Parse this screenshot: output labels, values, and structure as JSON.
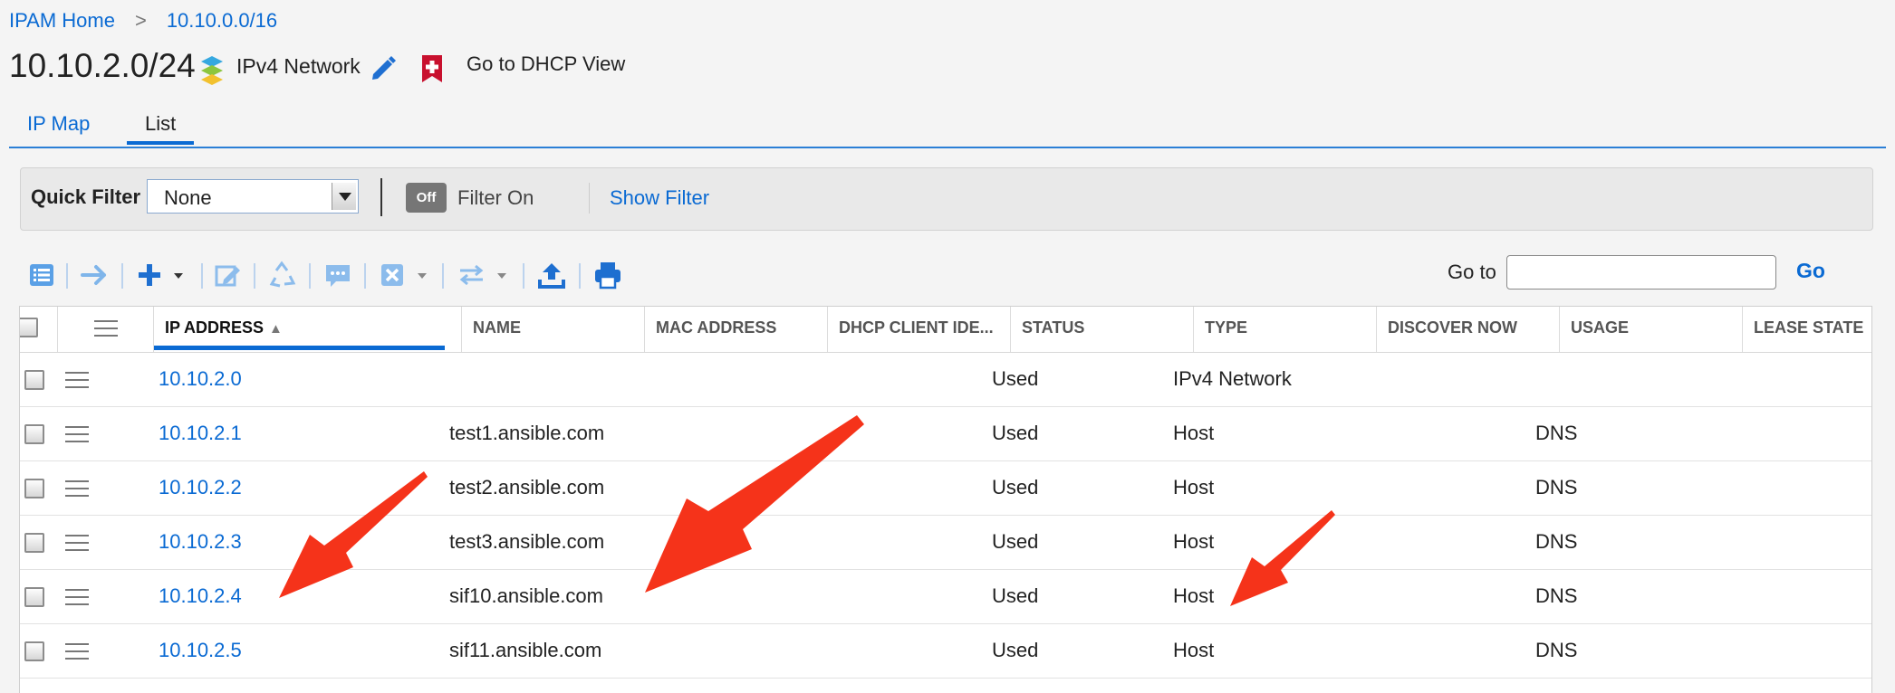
{
  "breadcrumb": {
    "home": "IPAM Home",
    "separator": ">",
    "current": "10.10.0.0/16"
  },
  "title": "10.10.2.0/24",
  "network_type": "IPv4 Network",
  "dhcp_view_label": "Go to DHCP View",
  "tabs": [
    {
      "label": "IP Map",
      "active": false
    },
    {
      "label": "List",
      "active": true
    }
  ],
  "quick_filter": {
    "label": "Quick Filter",
    "selected": "None",
    "toggle_label": "Off",
    "filter_on_label": "Filter On",
    "show_filter_label": "Show Filter"
  },
  "toolbar": {
    "icons": [
      "list-icon",
      "arrow-right-icon",
      "add-icon",
      "edit-icon",
      "recycle-icon",
      "comment-icon",
      "delete-icon",
      "transfer-icon",
      "upload-icon",
      "print-icon"
    ],
    "goto_label": "Go to",
    "goto_value": "",
    "go_label": "Go"
  },
  "table": {
    "columns": [
      "IP ADDRESS",
      "NAME",
      "MAC ADDRESS",
      "DHCP CLIENT IDE...",
      "STATUS",
      "TYPE",
      "DISCOVER NOW",
      "USAGE",
      "LEASE STATE"
    ],
    "sort": {
      "column": "IP ADDRESS",
      "direction": "ascending"
    },
    "rows": [
      {
        "ip": "10.10.2.0",
        "name": "",
        "status": "Used",
        "type": "IPv4 Network",
        "usage": ""
      },
      {
        "ip": "10.10.2.1",
        "name": "test1.ansible.com",
        "status": "Used",
        "type": "Host",
        "usage": "DNS"
      },
      {
        "ip": "10.10.2.2",
        "name": "test2.ansible.com",
        "status": "Used",
        "type": "Host",
        "usage": "DNS"
      },
      {
        "ip": "10.10.2.3",
        "name": "test3.ansible.com",
        "status": "Used",
        "type": "Host",
        "usage": "DNS"
      },
      {
        "ip": "10.10.2.4",
        "name": "sif10.ansible.com",
        "status": "Used",
        "type": "Host",
        "usage": "DNS"
      },
      {
        "ip": "10.10.2.5",
        "name": "sif11.ansible.com",
        "status": "Used",
        "type": "Host",
        "usage": "DNS"
      }
    ]
  },
  "colors": {
    "link": "#0a6ad3",
    "annotation_arrow": "#f5331a",
    "toolbar_icon": "#2f80d6"
  }
}
